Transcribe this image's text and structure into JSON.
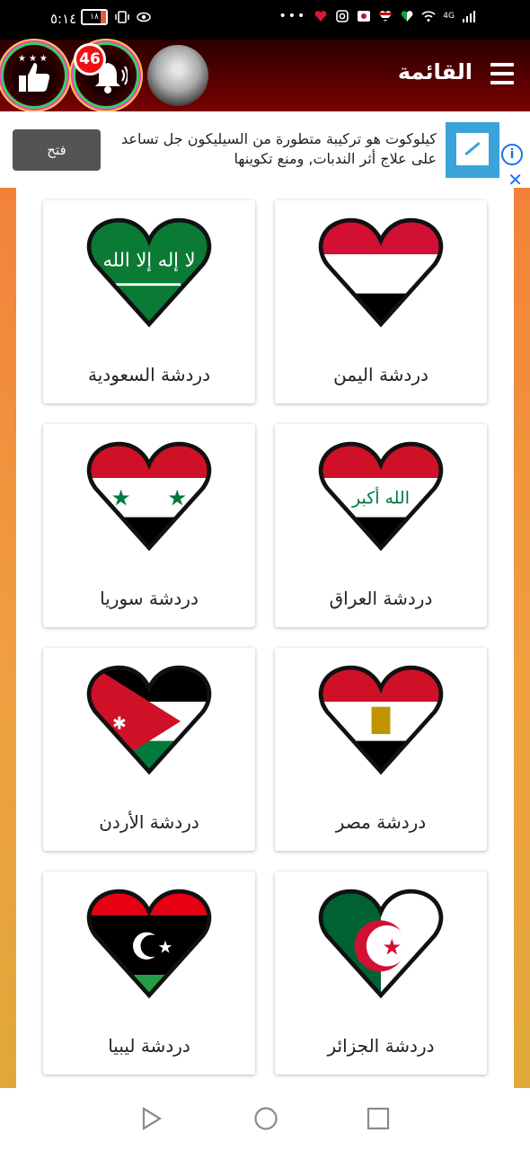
{
  "status_bar": {
    "time": "٥:١٤",
    "battery": "١٨",
    "network": "4G"
  },
  "app_bar": {
    "title": "القائمة",
    "notification_count": "46"
  },
  "ad": {
    "text": "كيلوكوت هو تركيبة متطورة من السيليكون جل تساعد على علاج أثر الندبات, ومنع تكوينها",
    "button": "فتح"
  },
  "cards": [
    {
      "label": "دردشة اليمن",
      "flag": "yemen"
    },
    {
      "label": "دردشة السعودية",
      "flag": "saudi"
    },
    {
      "label": "دردشة العراق",
      "flag": "iraq"
    },
    {
      "label": "دردشة سوريا",
      "flag": "syria"
    },
    {
      "label": "دردشة مصر",
      "flag": "egypt"
    },
    {
      "label": "دردشة الأردن",
      "flag": "jordan"
    },
    {
      "label": "دردشة الجزائر",
      "flag": "algeria"
    },
    {
      "label": "دردشة ليبيا",
      "flag": "libya"
    }
  ],
  "icons": {
    "menu": "hamburger-icon",
    "like": "thumbs-up-icon",
    "bell": "bell-icon",
    "info": "info-icon",
    "close": "close-icon",
    "back": "back-icon",
    "home": "home-icon",
    "recent": "recent-apps-icon"
  },
  "colors": {
    "app_bar": "#4a0000",
    "accent_orange": "#f2823a",
    "ad_button": "#545454",
    "ad_icon": "#1a73e8"
  }
}
